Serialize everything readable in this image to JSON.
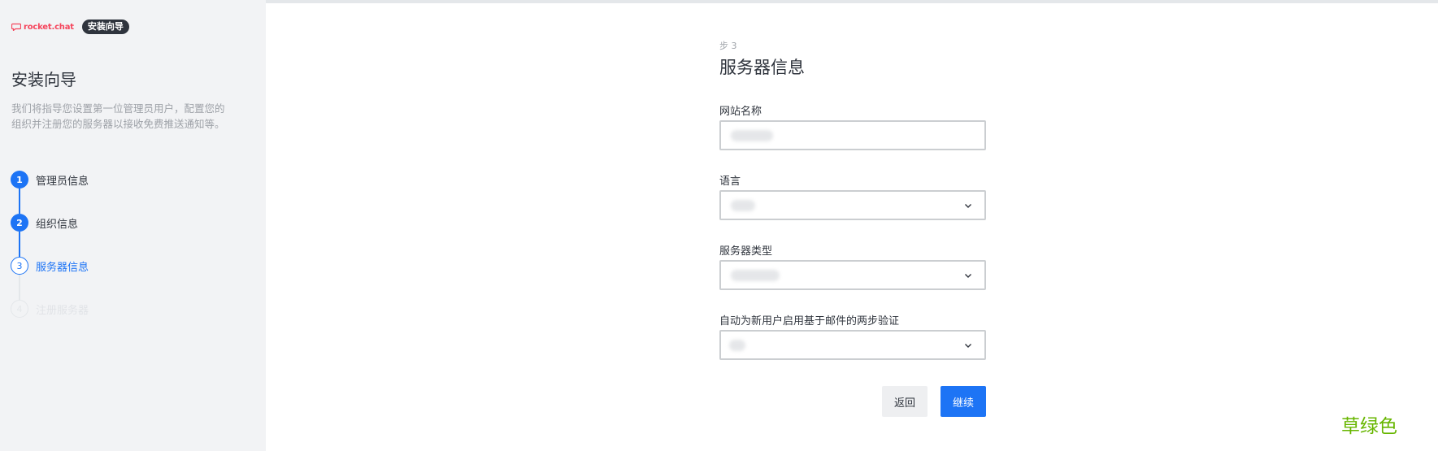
{
  "sidebar": {
    "logo_text": "rocket.chat",
    "badge": "安装向导",
    "title": "安装向导",
    "description": "我们将指导您设置第一位管理员用户，配置您的组织并注册您的服务器以接收免费推送通知等。",
    "steps": [
      {
        "number": "1",
        "label": "管理员信息",
        "state": "done"
      },
      {
        "number": "2",
        "label": "组织信息",
        "state": "done"
      },
      {
        "number": "3",
        "label": "服务器信息",
        "state": "current"
      },
      {
        "number": "4",
        "label": "注册服务器",
        "state": "upcoming"
      }
    ]
  },
  "form": {
    "step_label": "步 3",
    "title": "服务器信息",
    "fields": {
      "site_name": {
        "label": "网站名称"
      },
      "language": {
        "label": "语言"
      },
      "server_type": {
        "label": "服务器类型"
      },
      "two_factor": {
        "label": "自动为新用户启用基于邮件的两步验证"
      }
    },
    "back_label": "返回",
    "continue_label": "继续"
  },
  "watermark": "草绿色",
  "colors": {
    "accent": "#1d74f5",
    "brand_red": "#f5455c",
    "sidebar_bg": "#f2f3f5",
    "watermark": "#67b600"
  }
}
